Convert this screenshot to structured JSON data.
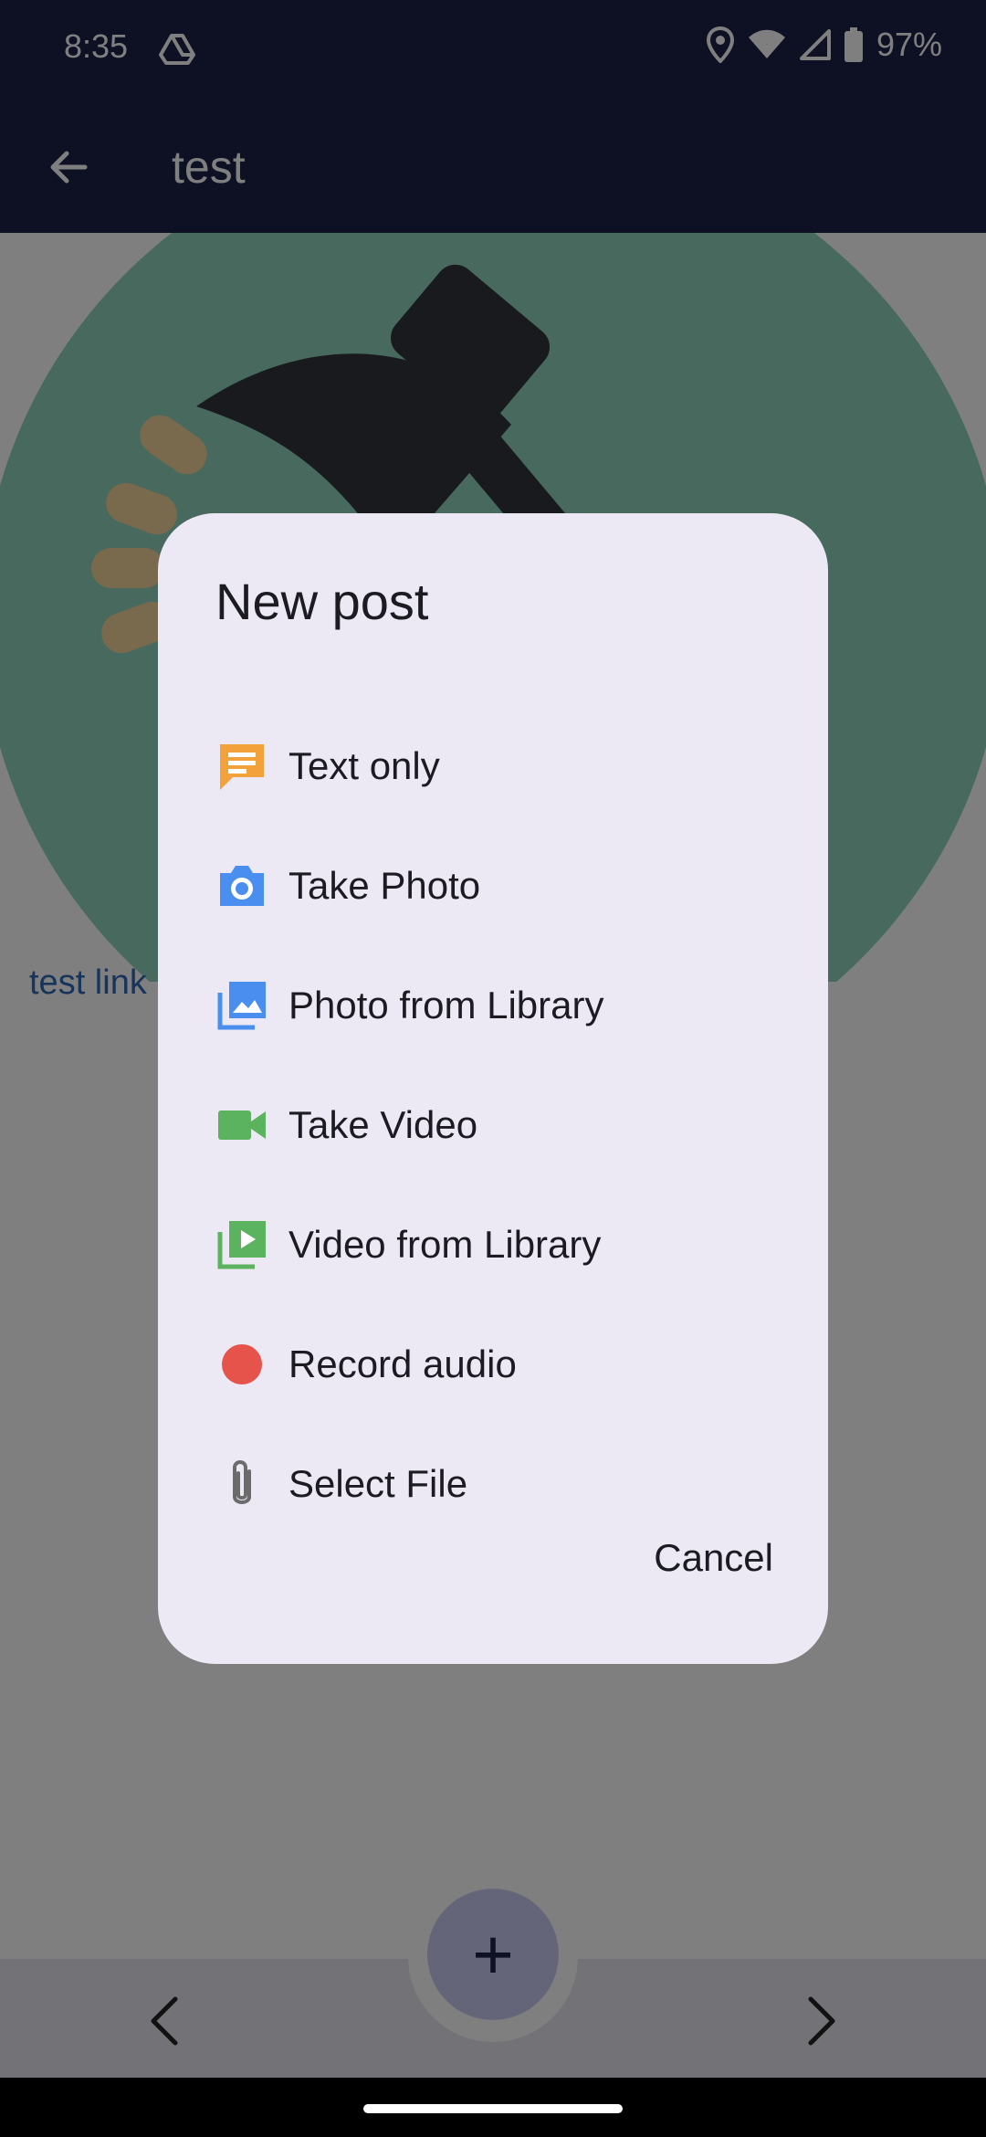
{
  "status_bar": {
    "time": "8:35",
    "battery": "97%",
    "icons": [
      "drive-icon",
      "location-icon",
      "wifi-icon",
      "signal-icon",
      "battery-icon"
    ]
  },
  "app_bar": {
    "title": "test",
    "back_icon": "arrow-left-icon"
  },
  "content": {
    "link_text": "test link"
  },
  "dialog": {
    "title": "New post",
    "options": [
      {
        "label": "Text only",
        "icon": "chat-bubble-icon",
        "color": "#f2a13b"
      },
      {
        "label": "Take Photo",
        "icon": "camera-icon",
        "color": "#4a8ef0"
      },
      {
        "label": "Photo from Library",
        "icon": "photo-library-icon",
        "color": "#4a8ef0"
      },
      {
        "label": "Take Video",
        "icon": "videocam-icon",
        "color": "#5bb25f"
      },
      {
        "label": "Video from Library",
        "icon": "video-library-icon",
        "color": "#5bb25f"
      },
      {
        "label": "Record audio",
        "icon": "record-dot-icon",
        "color": "#e5534b"
      },
      {
        "label": "Select File",
        "icon": "paperclip-icon",
        "color": "#6b6b6b"
      }
    ],
    "cancel_label": "Cancel"
  },
  "bottom_nav": {
    "fab_label": "+",
    "prev_icon": "chevron-left-icon",
    "next_icon": "chevron-right-icon"
  },
  "colors": {
    "app_bar": "#1c2048",
    "dialog_bg": "#ece9f5",
    "fab": "#c9cbf2",
    "link": "#2f69b8"
  }
}
